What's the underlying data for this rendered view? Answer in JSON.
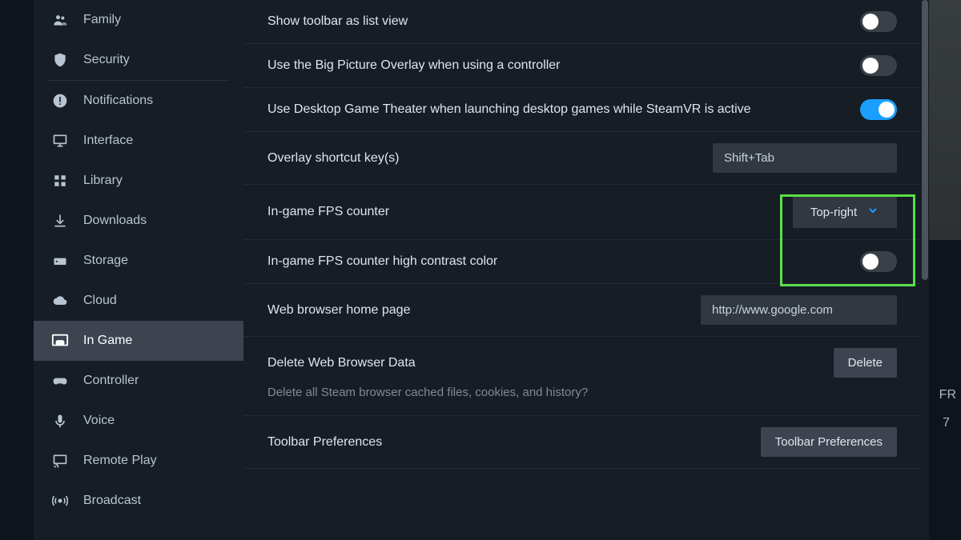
{
  "sidebar": {
    "items": [
      {
        "id": "family",
        "label": "Family",
        "icon": "users"
      },
      {
        "id": "security",
        "label": "Security",
        "icon": "shield"
      },
      {
        "id": "notifications",
        "label": "Notifications",
        "icon": "alert-circle"
      },
      {
        "id": "interface",
        "label": "Interface",
        "icon": "monitor"
      },
      {
        "id": "library",
        "label": "Library",
        "icon": "grid"
      },
      {
        "id": "downloads",
        "label": "Downloads",
        "icon": "download"
      },
      {
        "id": "storage",
        "label": "Storage",
        "icon": "hdd"
      },
      {
        "id": "cloud",
        "label": "Cloud",
        "icon": "cloud"
      },
      {
        "id": "in-game",
        "label": "In Game",
        "icon": "gamepad-window",
        "active": true
      },
      {
        "id": "controller",
        "label": "Controller",
        "icon": "gamepad"
      },
      {
        "id": "voice",
        "label": "Voice",
        "icon": "mic"
      },
      {
        "id": "remote-play",
        "label": "Remote Play",
        "icon": "cast"
      },
      {
        "id": "broadcast",
        "label": "Broadcast",
        "icon": "broadcast"
      }
    ]
  },
  "settings": {
    "show_toolbar_list_view": {
      "label": "Show toolbar as list view",
      "value": false
    },
    "big_picture_overlay": {
      "label": "Use the Big Picture Overlay when using a controller",
      "value": false
    },
    "desktop_game_theater": {
      "label": "Use Desktop Game Theater when launching desktop games while SteamVR is active",
      "value": true
    },
    "overlay_shortcut": {
      "label": "Overlay shortcut key(s)",
      "value": "Shift+Tab"
    },
    "fps_counter": {
      "label": "In-game FPS counter",
      "value": "Top-right"
    },
    "fps_high_contrast": {
      "label": "In-game FPS counter high contrast color",
      "value": false
    },
    "browser_home": {
      "label": "Web browser home page",
      "value": "http://www.google.com"
    },
    "delete_browser_data": {
      "label": "Delete Web Browser Data",
      "button": "Delete",
      "desc": "Delete all Steam browser cached files, cookies, and history?"
    },
    "toolbar_prefs": {
      "label": "Toolbar Preferences",
      "button": "Toolbar Preferences"
    }
  },
  "right_strip": {
    "text1": "FR",
    "text2": "7"
  }
}
